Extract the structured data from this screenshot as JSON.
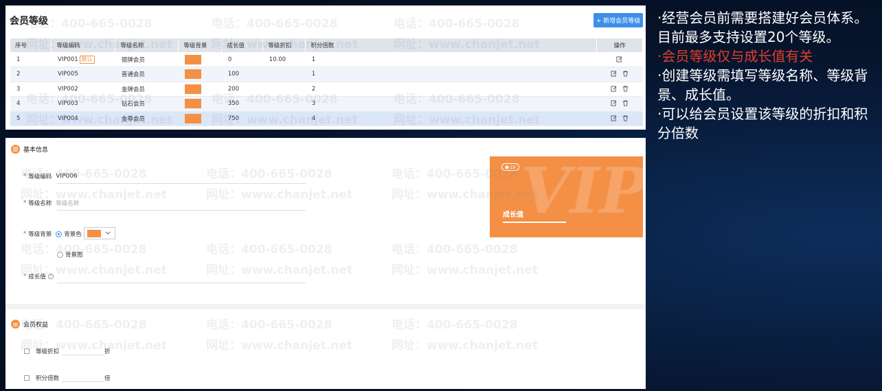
{
  "levels_panel": {
    "title": "会员等级",
    "add_button": "+ 新增会员等级",
    "columns": [
      "序号",
      "等级编码",
      "等级名称",
      "等级背景",
      "成长值",
      "等级折扣",
      "积分倍数",
      "操作"
    ],
    "rows": [
      {
        "index": "1",
        "code": "VIP001",
        "badge": "默认",
        "name": "银牌会员",
        "growth": "0",
        "discount": "10.00",
        "multiplier": "1"
      },
      {
        "index": "2",
        "code": "VIP005",
        "badge": "",
        "name": "普通会员",
        "growth": "100",
        "discount": "",
        "multiplier": "1"
      },
      {
        "index": "3",
        "code": "VIP002",
        "badge": "",
        "name": "金牌会员",
        "growth": "200",
        "discount": "",
        "multiplier": "2"
      },
      {
        "index": "4",
        "code": "VIP003",
        "badge": "",
        "name": "钻石会员",
        "growth": "350",
        "discount": "",
        "multiplier": "3"
      },
      {
        "index": "5",
        "code": "VIP004",
        "badge": "",
        "name": "金尊会员",
        "growth": "750",
        "discount": "",
        "multiplier": "4"
      }
    ]
  },
  "form": {
    "basic_section": "基本信息",
    "code_label": "等级编码",
    "code_value": "VIP006",
    "name_label": "等级名称",
    "name_placeholder": "等级名称",
    "bg_label": "等级背景",
    "bg_color_option": "背景色",
    "bg_image_option": "背景图",
    "growth_label": "成长值",
    "benefits_section": "会员权益",
    "discount_label": "等级折扣",
    "discount_unit": "折",
    "multiplier_label": "积分倍数",
    "multiplier_unit": "倍"
  },
  "preview_card": {
    "lv_tag": "LV",
    "growth_text": "成长值",
    "bg_letters": "VIP"
  },
  "watermark": {
    "phone": "电话：400-665-0028",
    "site": "网址：www.chanjet.net"
  },
  "notes": {
    "line1": "·经营会员前需要搭建好会员体系。目前最多支持设置20个等级。",
    "line2": "·会员等级仅与成长值有关",
    "line3": "·创建等级需填写等级名称、等级背景、成长值。",
    "line4": "·可以给会员设置该等级的折扣和积分倍数"
  },
  "colors": {
    "accent": "#3d8fea",
    "level_bg": "#f49046",
    "highlight": "#e23d2c"
  }
}
